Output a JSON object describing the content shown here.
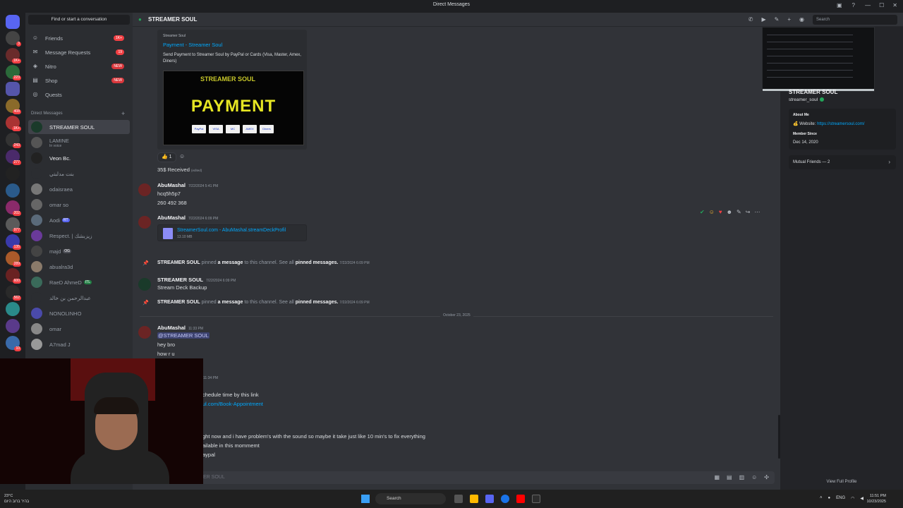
{
  "window": {
    "title": "Direct Messages"
  },
  "sidebar": {
    "find_label": "Find or start a conversation",
    "nav": [
      {
        "label": "Friends",
        "icon": "friends-icon",
        "badge": "1K+"
      },
      {
        "label": "Message Requests",
        "icon": "mail-icon",
        "badge": "19"
      },
      {
        "label": "Nitro",
        "icon": "nitro-icon",
        "badge": "NEW"
      },
      {
        "label": "Shop",
        "icon": "shop-icon",
        "badge": "NEW"
      },
      {
        "label": "Quests",
        "icon": "quests-icon",
        "badge": ""
      }
    ],
    "dm_header": "Direct Messages",
    "dms": [
      {
        "name": "STREAMER SOUL",
        "sub": "",
        "tag": ""
      },
      {
        "name": "LAMINE",
        "sub": "In voice",
        "tag": ""
      },
      {
        "name": "Veon Bc.",
        "sub": "",
        "tag": ""
      },
      {
        "name": "بنت مدلبتي",
        "sub": "",
        "tag": ""
      },
      {
        "name": "odaisraea",
        "sub": "",
        "tag": ""
      },
      {
        "name": "omar so",
        "sub": "",
        "tag": ""
      },
      {
        "name": "Aodi",
        "sub": "",
        "tag": "RT"
      },
      {
        "name": "Respect. | زيزبشك",
        "sub": "",
        "tag": ""
      },
      {
        "name": "majd",
        "sub": "",
        "tag": "OG"
      },
      {
        "name": "abualra3d",
        "sub": "",
        "tag": ""
      },
      {
        "name": "RaeD AhmeD",
        "sub": "",
        "tag": "ITL"
      },
      {
        "name": "عبدالرحمن بن خالد",
        "sub": "",
        "tag": ""
      },
      {
        "name": "NONOLINHO",
        "sub": "",
        "tag": ""
      },
      {
        "name": "omar",
        "sub": "",
        "tag": ""
      },
      {
        "name": "A7mad J",
        "sub": "",
        "tag": ""
      }
    ],
    "server_badges": [
      "3",
      "1K+",
      "223",
      "408",
      "1K+",
      "243",
      "277",
      "202",
      "977",
      "135",
      "289",
      "600",
      "562",
      "10"
    ]
  },
  "chat": {
    "channel_name": "STREAMER SOUL",
    "search_placeholder": "Search",
    "embed": {
      "provider": "Streamer Soul",
      "title": "Payment - Streamer Soul",
      "description": "Send Payment to Streamer Soul by PayPal or Cards (Visa, Master, Amex, Diners)",
      "image_logo": "STREAMER SOUL",
      "image_text": "PAYMENT",
      "cards": [
        "PayPal",
        "VISA",
        "MC",
        "AMEX",
        "Diners"
      ]
    },
    "reaction": {
      "emoji": "👍",
      "count": "1"
    },
    "received": {
      "text": "35$ Received",
      "edited": "(edited)"
    },
    "messages": [
      {
        "author": "AbuMashal",
        "time": "7/22/2024 5:41 PM",
        "lines": [
          "hcq5h5p7",
          "260 492 368"
        ]
      },
      {
        "author": "AbuMashal",
        "time": "7/22/2024 6:09 PM",
        "file_name": "StreamerSoul.com - AbuMashal.streamDeckProfil",
        "file_size": "13.10 MB"
      },
      {
        "author": "STREAMER SOUL",
        "time": "7/22/2024 6:09 PM",
        "lines": [
          "Stream Deck Backup"
        ]
      },
      {
        "author": "AbuMashal",
        "time": "11:33 PM",
        "mention": "@STREAMER SOUL",
        "lines": [
          "hey bro",
          "how r u"
        ]
      }
    ],
    "system": {
      "author": "STREAMER SOUL",
      "pinned": "pinned",
      "a_message": "a message",
      "to_channel": "to this channel. See all",
      "pinned_messages": "pinned messages.",
      "time": "7/22/2024 6:09 PM"
    },
    "date_divider": "October 23, 2025",
    "partial": {
      "time": "11:34 PM",
      "line1": "chedule time by this link",
      "link": "ul.com/Book-Appointment",
      "line2": "ght now and i have problem's with the sound so maybe it take just like 10 min's to fix everything",
      "line3": "ailable in this mommemt",
      "line4": "aypal"
    },
    "composer_placeholder": "ER SOUL"
  },
  "profile": {
    "display_name": "STREAMER SOUL",
    "username": "streamer_soul",
    "about_label": "About Me",
    "website_prefix": "Website:",
    "website": "https://streamersoul.com/",
    "member_since_label": "Member Since",
    "member_since": "Dec 14, 2020",
    "mutual": "Mutual Friends — 2",
    "view_full": "View Full Profile"
  },
  "taskbar": {
    "temp": "23°C",
    "weather_text": "בהיר ברוב היום",
    "search": "Search",
    "lang": "ENG",
    "time": "11:51 PM",
    "date": "10/23/2025"
  }
}
